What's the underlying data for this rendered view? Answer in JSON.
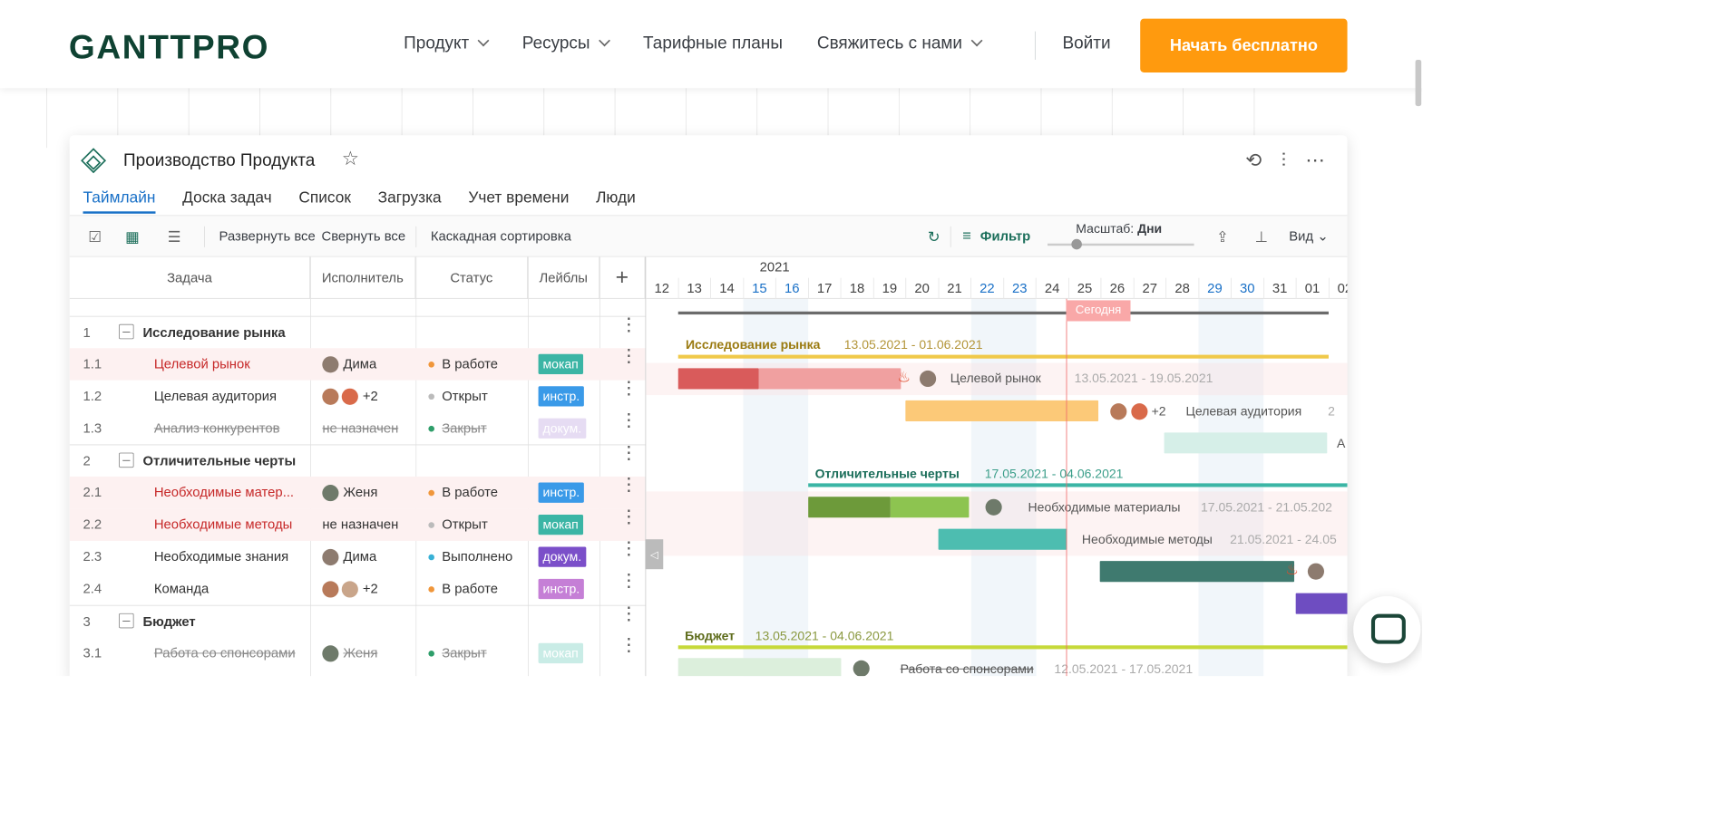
{
  "header": {
    "logo": "GANTTPRO",
    "nav": [
      "Продукт",
      "Ресурсы",
      "Тарифные планы",
      "Свяжитесь с нами"
    ],
    "login": "Войти",
    "cta": "Начать бесплатно"
  },
  "project": {
    "title": "Производство Продукта",
    "tabs": [
      "Таймлайн",
      "Доска задач",
      "Список",
      "Загрузка",
      "Учет времени",
      "Люди"
    ]
  },
  "toolbar": {
    "expand": "Развернуть все",
    "collapse": "Свернуть все",
    "cascade": "Каскадная сортировка",
    "filter": "Фильтр",
    "scale_prefix": "Масштаб:",
    "scale_value": "Дни",
    "view": "Вид"
  },
  "columns": [
    "Задача",
    "Исполнитель",
    "Статус",
    "Лейблы"
  ],
  "rows": [
    {
      "num": "1",
      "name": "Исследование рынка",
      "group": true
    },
    {
      "num": "1.1",
      "name": "Целевой рынок",
      "assignee": "Дима",
      "status": "В работе",
      "label": "мокап",
      "overdue": true
    },
    {
      "num": "1.2",
      "name": "Целевая аудитория",
      "assignee": "+2",
      "status": "Открыт",
      "label": "инстр."
    },
    {
      "num": "1.3",
      "name": "Анализ конкурентов",
      "assignee": "не назначен",
      "status": "Закрыт",
      "label": "докум.",
      "done": true
    },
    {
      "num": "2",
      "name": "Отличительные черты",
      "group": true
    },
    {
      "num": "2.1",
      "name": "Необходимые матер...",
      "assignee": "Женя",
      "status": "В работе",
      "label": "инстр.",
      "overdue": true
    },
    {
      "num": "2.2",
      "name": "Необходимые методы",
      "assignee": "не назначен",
      "status": "Открыт",
      "label": "мокап",
      "overdue": true
    },
    {
      "num": "2.3",
      "name": "Необходимые знания",
      "assignee": "Дима",
      "status": "Выполнено",
      "label": "докум."
    },
    {
      "num": "2.4",
      "name": "Команда",
      "assignee": "+2",
      "status": "В работе",
      "label": "инстр."
    },
    {
      "num": "3",
      "name": "Бюджет",
      "group": true
    },
    {
      "num": "3.1",
      "name": "Работа со спонсорами",
      "assignee": "Женя",
      "status": "Закрыт",
      "label": "мокап",
      "done": true
    }
  ],
  "gantt": {
    "year": "2021",
    "days": [
      "12",
      "13",
      "14",
      "15",
      "16",
      "17",
      "18",
      "19",
      "20",
      "21",
      "22",
      "23",
      "24",
      "25",
      "26",
      "27",
      "28",
      "29",
      "30",
      "31",
      "01",
      "02"
    ],
    "today": "Сегодня",
    "bars_text": {
      "g1": "Исследование рынка",
      "g1_dates": "13.05.2021 - 01.06.2021",
      "t11": "Целевой рынок",
      "t11_dates": "13.05.2021 - 19.05.2021",
      "t12_count": "+2",
      "t12": "Целевая аудитория",
      "t12_trunc": "2",
      "t13_trunc": "А",
      "g2": "Отличительные черты",
      "g2_dates": "17.05.2021 - 04.06.2021",
      "t21": "Необходимые материалы",
      "t21_dates": "17.05.2021 - 21.05.202",
      "t22": "Необходимые методы",
      "t22_dates": "21.05.2021 - 24.05",
      "g3": "Бюджет",
      "g3_dates": "13.05.2021 - 04.06.2021",
      "t31": "Работа со спонсорами",
      "t31_dates": "12.05.2021 - 17.05.2021"
    }
  },
  "colors": {
    "accent": "#1970c7",
    "cta": "#ff9a0e",
    "brand": "#0f4232"
  }
}
